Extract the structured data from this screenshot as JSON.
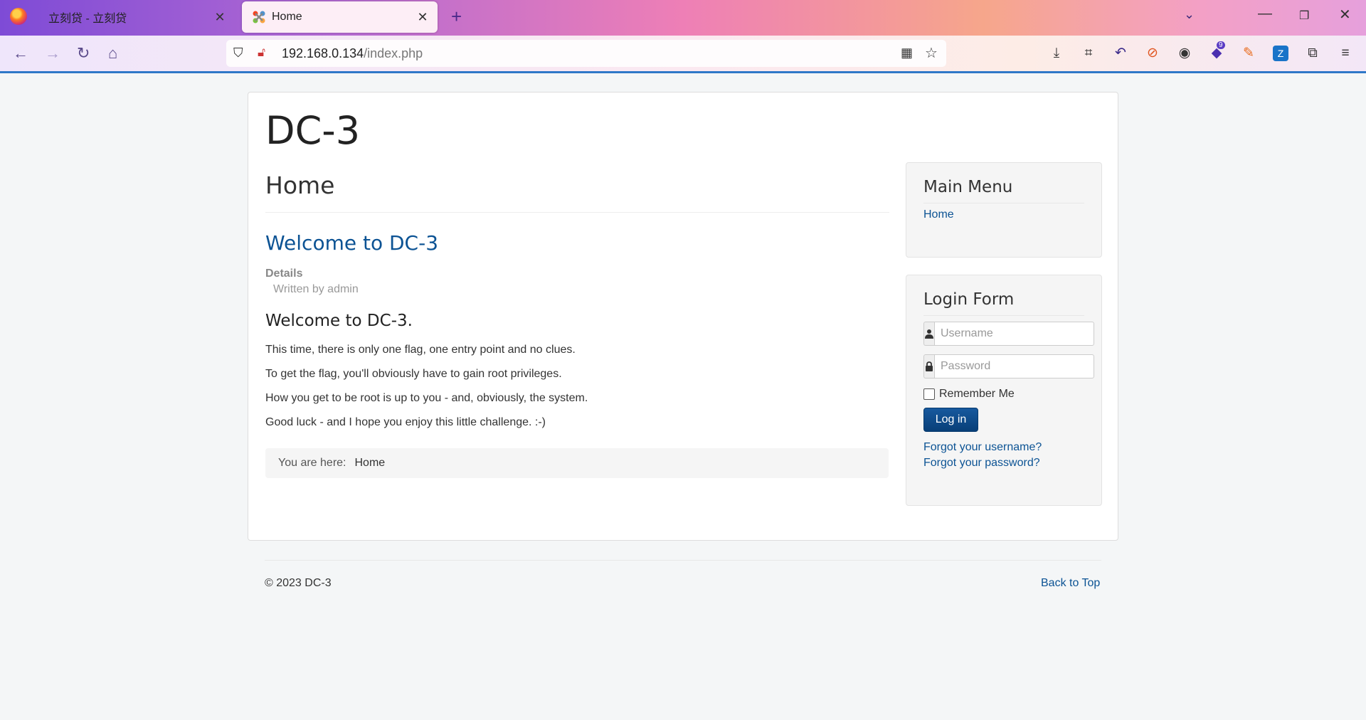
{
  "browser": {
    "tabs": [
      {
        "title": "立刻贷 - 立刻贷",
        "active": false
      },
      {
        "title": "Home",
        "active": true
      }
    ],
    "url_host": "192.168.0.134",
    "url_path": "/index.php",
    "toolbar_badge": "9"
  },
  "page": {
    "site_title": "DC-3",
    "page_heading": "Home",
    "article_title": "Welcome to DC-3",
    "details_label": "Details",
    "author_line": "Written by admin",
    "body_heading": "Welcome to DC-3.",
    "paragraphs": [
      "This time, there is only one flag, one entry point and no clues.",
      "To get the flag, you'll obviously have to gain root privileges.",
      "How you get to be root is up to you - and, obviously, the system.",
      "Good luck - and I hope you enjoy this little challenge.  :-)"
    ],
    "breadcrumb_label": "You are here:",
    "breadcrumb_current": "Home"
  },
  "sidebar": {
    "main_menu_title": "Main Menu",
    "main_menu_items": [
      "Home"
    ],
    "login": {
      "title": "Login Form",
      "username_placeholder": "Username",
      "password_placeholder": "Password",
      "remember_label": "Remember Me",
      "button_label": "Log in",
      "forgot_username": "Forgot your username?",
      "forgot_password": "Forgot your password?"
    }
  },
  "footer": {
    "copyright": "© 2023 DC-3",
    "back_to_top": "Back to Top"
  },
  "colors": {
    "link": "#0c5394",
    "button": "#0b4a8a",
    "accent_bar": "#2f78c8"
  }
}
